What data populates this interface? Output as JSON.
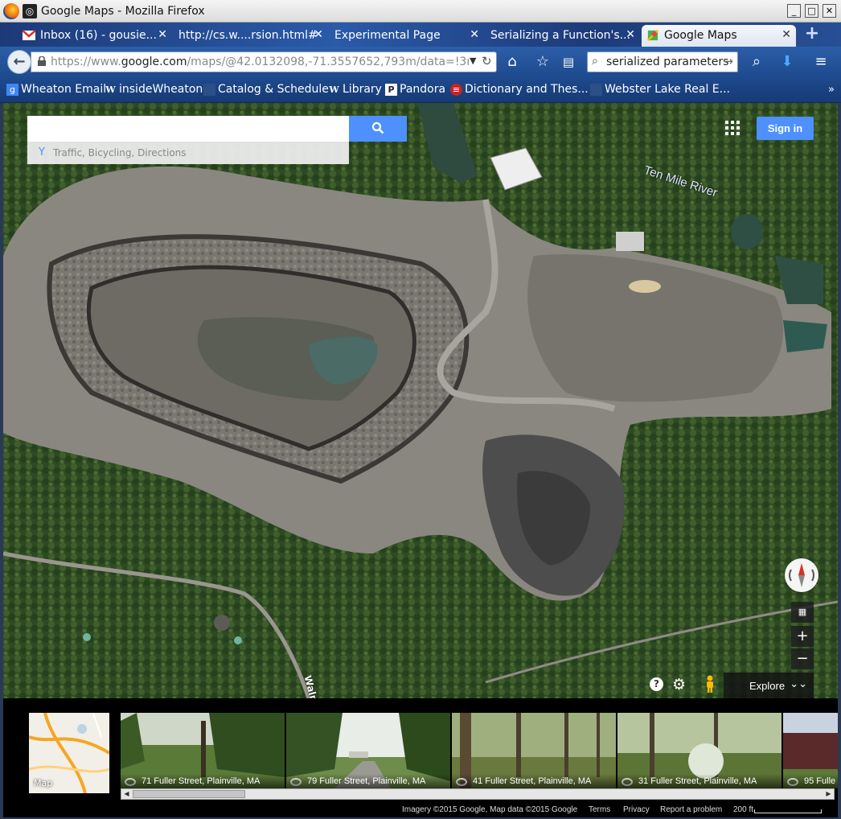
{
  "window": {
    "title": "Google Maps - Mozilla Firefox",
    "min": "_",
    "max": "□",
    "close": "✕"
  },
  "tabs": [
    {
      "label": "Inbox (16) - gousie...",
      "icon": "gmail-icon",
      "active": false
    },
    {
      "label": "http://cs.w....rsion.html#",
      "icon": "page-icon",
      "active": false
    },
    {
      "label": "Experimental Page",
      "icon": "page-icon",
      "active": false
    },
    {
      "label": "Serializing a Function's...",
      "icon": "page-icon",
      "active": false
    },
    {
      "label": "Google Maps",
      "icon": "maps-icon",
      "active": true
    }
  ],
  "tab_close": "✕",
  "newtab": "+",
  "url": {
    "prefix": "https://www.",
    "domain": "google.com",
    "rest": "/maps/@42.0132098,-71.3557652,793m/data=!3m1!1e3"
  },
  "search": {
    "query": "serialized parameters"
  },
  "bookmarks": [
    {
      "label": "Wheaton Email",
      "icon": "google-icon",
      "glyph": "g"
    },
    {
      "label": "insideWheaton",
      "icon": "wheaton-icon",
      "glyph": "W"
    },
    {
      "label": "Catalog & Schedule",
      "icon": "page-icon",
      "glyph": ""
    },
    {
      "label": "Library",
      "icon": "wheaton-icon",
      "glyph": "W"
    },
    {
      "label": "Pandora",
      "icon": "pandora-icon",
      "glyph": "P"
    },
    {
      "label": "Dictionary and Thes...",
      "icon": "dictionary-icon",
      "glyph": "≡"
    },
    {
      "label": "Webster Lake Real E...",
      "icon": "page-icon",
      "glyph": ""
    }
  ],
  "bookmarks_more": "»",
  "map": {
    "search_placeholder": "",
    "suggest": "Traffic, Bicycling, Directions",
    "signin": "Sign in",
    "river_label": "Ten Mile River",
    "road_label": "Walnu",
    "zoom_in": "+",
    "zoom_out": "−",
    "explore": "Explore",
    "help": "?"
  },
  "filmstrip": {
    "minimap_label": "Map",
    "thumbs": [
      {
        "caption": "71 Fuller Street, Plainville, MA"
      },
      {
        "caption": "79 Fuller Street, Plainville, MA"
      },
      {
        "caption": "41 Fuller Street, Plainville, MA"
      },
      {
        "caption": "31 Fuller Street, Plainville, MA"
      },
      {
        "caption": "95 Fulle"
      }
    ]
  },
  "footer": {
    "imagery": "Imagery ©2015 Google, Map data ©2015 Google",
    "terms": "Terms",
    "privacy": "Privacy",
    "report": "Report a problem",
    "scale": "200 ft"
  },
  "colors": {
    "accent": "#4d90fe",
    "tabstrip": "#2a5aa8"
  }
}
